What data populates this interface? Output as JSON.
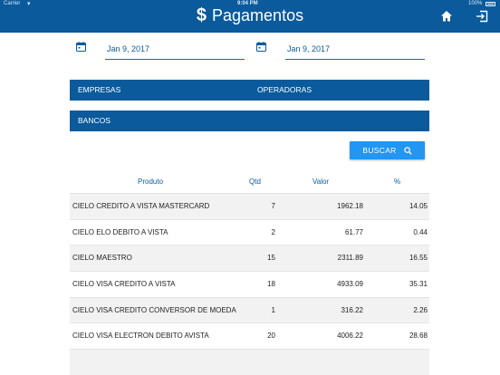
{
  "status_bar": {
    "carrier": "Carrier",
    "time": "9:04 PM",
    "battery": "100%"
  },
  "header": {
    "currency_symbol": "$",
    "title": "Pagamentos",
    "color": "#0a5a9c"
  },
  "filters": {
    "date_start": "Jan 9, 2017",
    "date_end": "Jan 9, 2017",
    "empresas_label": "EMPRESAS",
    "operadoras_label": "OPERADORAS",
    "bancos_label": "BANCOS",
    "search_label": "BUSCAR",
    "search_color": "#2196f3"
  },
  "table": {
    "headers": {
      "produto": "Produto",
      "qtd": "Qtd",
      "valor": "Valor",
      "pct": "%"
    },
    "rows": [
      {
        "produto": "CIELO CREDITO A VISTA MASTERCARD",
        "qtd": "7",
        "valor": "1962.18",
        "pct": "14.05"
      },
      {
        "produto": "CIELO ELO DEBITO A VISTA",
        "qtd": "2",
        "valor": "61.77",
        "pct": "0.44"
      },
      {
        "produto": "CIELO MAESTRO",
        "qtd": "15",
        "valor": "2311.89",
        "pct": "16.55"
      },
      {
        "produto": "CIELO VISA CREDITO A VISTA",
        "qtd": "18",
        "valor": "4933.09",
        "pct": "35.31"
      },
      {
        "produto": "CIELO VISA CREDITO CONVERSOR DE MOEDA",
        "qtd": "1",
        "valor": "316.22",
        "pct": "2.26"
      },
      {
        "produto": "CIELO VISA ELECTRON DEBITO AVISTA",
        "qtd": "20",
        "valor": "4006.22",
        "pct": "28.68"
      }
    ]
  }
}
